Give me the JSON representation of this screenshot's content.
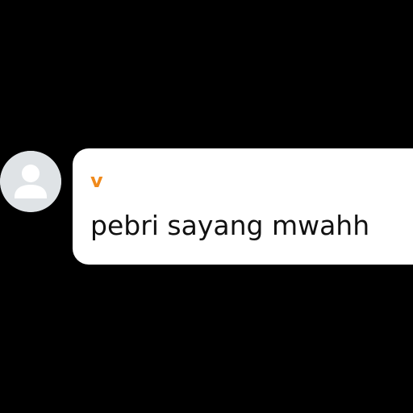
{
  "message": {
    "sender_name": "v",
    "text": "pebri sayang mwahh",
    "avatar_icon": "default-user-avatar-icon"
  },
  "colors": {
    "background": "#000000",
    "bubble": "#ffffff",
    "sender_name": "#f08a1c",
    "message_text": "#111111",
    "avatar_bg": "#dfe3e6",
    "avatar_figure": "#ffffff"
  }
}
